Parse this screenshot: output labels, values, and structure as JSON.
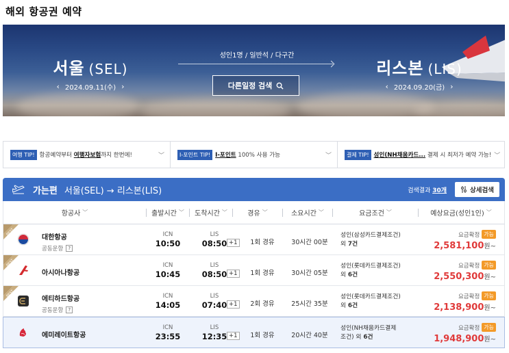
{
  "page_title": "해외 항공권 예약",
  "hero": {
    "origin_name": "서울",
    "origin_code": "(SEL)",
    "origin_date": "2024.09.11(수)",
    "dest_name": "리스본",
    "dest_code": "(LIS)",
    "dest_date": "2024.09.20(금)",
    "passengers": "성인1명 / 일반석 / 다구간",
    "other_search_label": "다른일정 검색",
    "prev_arrow": "‹",
    "next_arrow": "›"
  },
  "tips": [
    {
      "tag": "여행 TIP!",
      "pre": "항공예약부터 ",
      "bold": "여행자보험",
      "post": "까지 한번에!"
    },
    {
      "tag": "I-포인트 TIP!",
      "pre": "",
      "bold": "I-포인트",
      "post": " 100% 사용 가능"
    },
    {
      "tag": "결제 TIP!",
      "pre": "",
      "bold": "성인(NH채움카드...",
      "post": " 결제 시 최저가 예약 가능!"
    }
  ],
  "result": {
    "direction": "가는편",
    "route": "서울(SEL) → 리스본(LIS)",
    "count_prefix": "검색결과 ",
    "count_value": "30개",
    "detail_button": "상세검색"
  },
  "columns": {
    "airline": "항공사",
    "depart": "출발시간",
    "arrive": "도착시간",
    "via": "경유",
    "duration": "소요시간",
    "condition": "요금조건",
    "fare": "예상요금(성인1인)"
  },
  "flights": [
    {
      "airline": "대한항공",
      "codeshare": "공동운항",
      "q": "?",
      "best": "BEST",
      "dep_code": "ICN",
      "dep_time": "10:50",
      "arr_code": "LIS",
      "arr_time": "08:50",
      "plus": "+1",
      "stops": "1회 경유",
      "duration": "30시간 00분",
      "cond_line1": "성인(삼성카드결제조건)",
      "cond_count_pre": "외 ",
      "cond_count": "7건",
      "fare_status": "요금확정",
      "avail": "가능",
      "price": "2,581,100",
      "won": "원~"
    },
    {
      "airline": "아시아나항공",
      "codeshare": "",
      "q": "",
      "best": "BEST",
      "dep_code": "ICN",
      "dep_time": "10:45",
      "arr_code": "LIS",
      "arr_time": "08:50",
      "plus": "+1",
      "stops": "1회 경유",
      "duration": "30시간 05분",
      "cond_line1": "성인(롯데카드결제조건)",
      "cond_count_pre": "외 ",
      "cond_count": "6건",
      "fare_status": "요금확정",
      "avail": "가능",
      "price": "2,550,300",
      "won": "원~"
    },
    {
      "airline": "에티하드항공",
      "codeshare": "공동운항",
      "q": "?",
      "best": "BEST",
      "dep_code": "ICN",
      "dep_time": "14:05",
      "arr_code": "LIS",
      "arr_time": "07:40",
      "plus": "+1",
      "stops": "2회 경유",
      "duration": "25시간 35분",
      "cond_line1": "성인(롯데카드결제조건)",
      "cond_count_pre": "외 ",
      "cond_count": "6건",
      "fare_status": "요금확정",
      "avail": "가능",
      "price": "2,138,900",
      "won": "원~"
    },
    {
      "airline": "에미레이트항공",
      "codeshare": "",
      "q": "",
      "best": "",
      "dep_code": "ICN",
      "dep_time": "23:55",
      "arr_code": "LIS",
      "arr_time": "12:35",
      "plus": "+1",
      "stops": "1회 경유",
      "duration": "20시간 40분",
      "cond_line1": "성인(NH채움카드결제",
      "cond_line2": "조건) 외 ",
      "cond_count": "6건",
      "fare_status": "요금확정",
      "avail": "가능",
      "price": "1,948,900",
      "won": "원~"
    }
  ],
  "colors": {
    "accent": "#3b6ec5",
    "price": "#e03a3a",
    "available": "#f39a28",
    "best_ribbon": "#b89a6b"
  }
}
